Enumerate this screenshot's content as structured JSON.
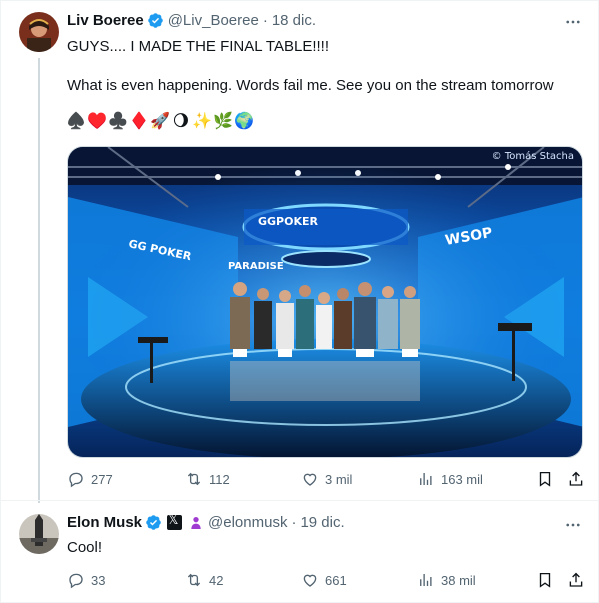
{
  "main_tweet": {
    "author_name": "Liv Boeree",
    "handle": "@Liv_Boeree",
    "separator": "·",
    "date": "18 dic.",
    "line1": "GUYS.... I MADE THE FINAL TABLE!!!!",
    "line2": "What is even happening. Words fail me. See you on the stream tomorrow",
    "emojis": [
      "♠️",
      "♥️",
      "♣️",
      "♦️",
      "🚀",
      "🌖",
      "✨",
      "🌿",
      "🌍"
    ],
    "image_credit": "© Tomás Stacha",
    "image_signs": [
      "GGPOKER",
      "PARADISE",
      "WSOP"
    ],
    "metrics": {
      "replies": "277",
      "reposts": "112",
      "likes": "3 mil",
      "views": "163 mil"
    }
  },
  "reply_tweet": {
    "author_name": "Elon Musk",
    "handle": "@elonmusk",
    "separator": "·",
    "date": "19 dic.",
    "text": "Cool!",
    "metrics": {
      "replies": "33",
      "reposts": "42",
      "likes": "661",
      "views": "38 mil"
    }
  },
  "colors": {
    "verified": "#1d9bf0",
    "secondary_text": "#536471",
    "text": "#0f1419",
    "border": "#eff3f4",
    "affiliate_purple": "#a03bd1"
  },
  "icons": [
    "more-icon",
    "reply-icon",
    "repost-icon",
    "like-icon",
    "views-icon",
    "bookmark-icon",
    "share-icon",
    "verified-icon",
    "x-affiliate-icon"
  ]
}
